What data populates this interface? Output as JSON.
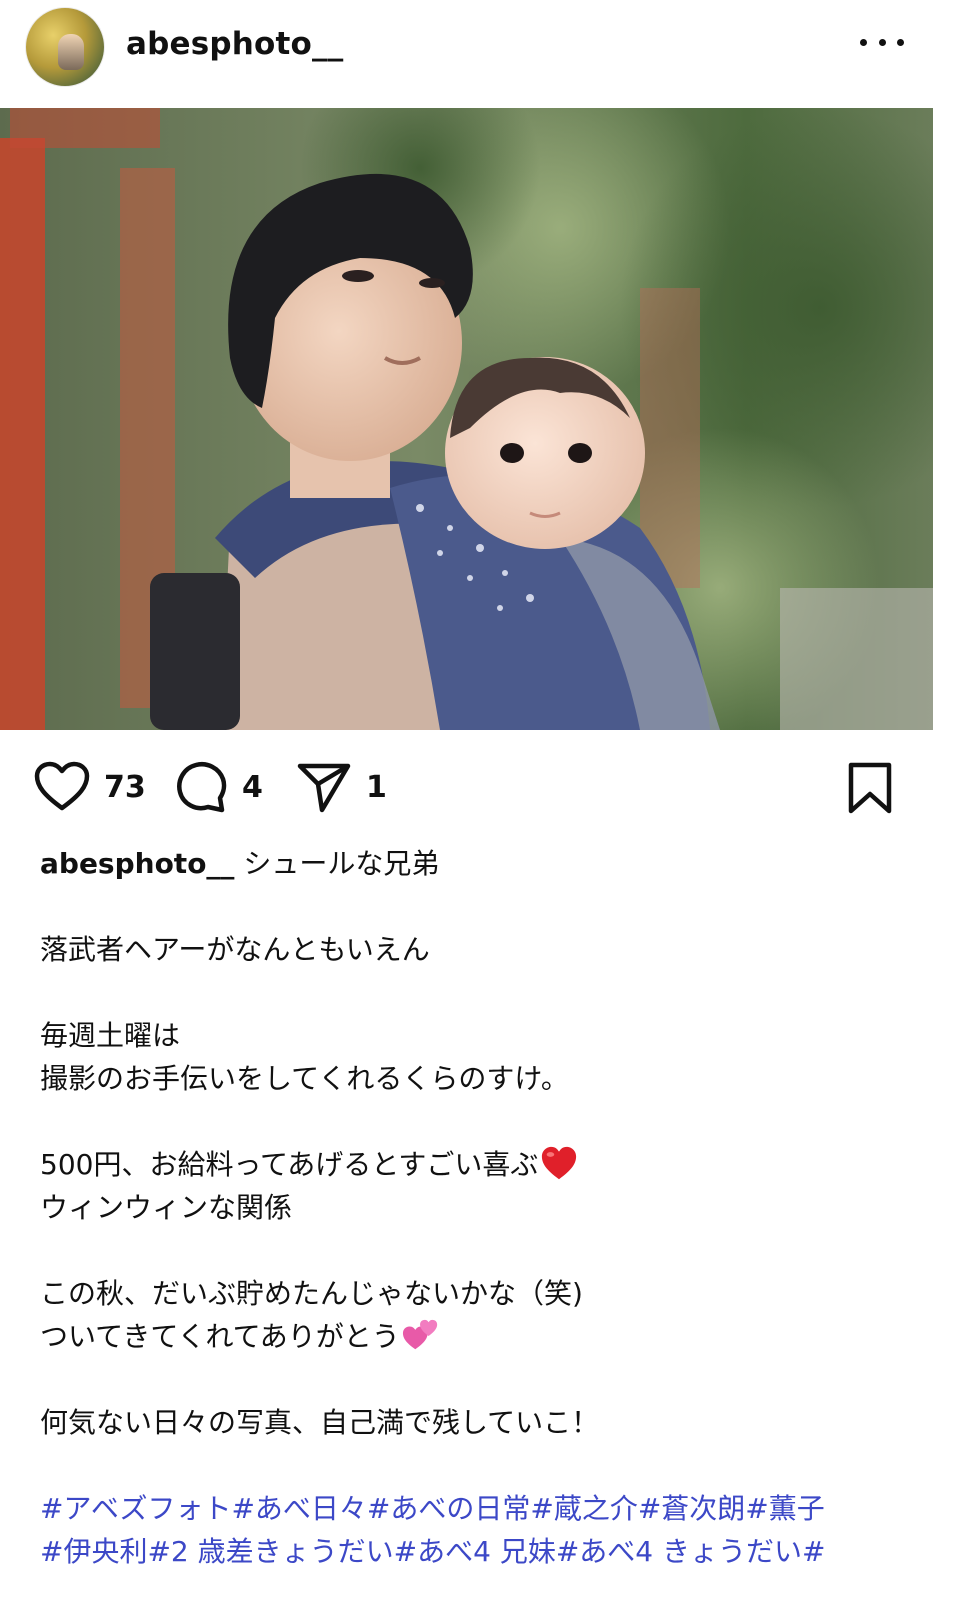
{
  "post": {
    "username": "abesphoto__",
    "more_icon": "more-horizontal-icon"
  },
  "actions": {
    "likes": "73",
    "comments": "4",
    "shares": "1",
    "like_icon": "heart-icon",
    "comment_icon": "comment-bubble-icon",
    "share_icon": "paper-plane-icon",
    "save_icon": "bookmark-icon"
  },
  "caption": {
    "username": "abesphoto__",
    "title": "シュールな兄弟",
    "lines": [
      "落武者ヘアーがなんともいえん",
      "",
      "毎週土曜は",
      "撮影のお手伝いをしてくれるくらのすけ。",
      "",
      "500円、お給料ってあげるとすごい喜ぶ",
      "ウィンウィンな関係",
      "",
      "この秋、だいぶ貯めたんじゃないかな（笑)",
      "ついてきてくれてありがとう",
      "",
      "何気ない日々の写真、自己満で残していこ！"
    ],
    "emoji": {
      "red_heart": "red-heart-emoji",
      "two_hearts": "two-hearts-emoji"
    },
    "hashtag_line_1": "#アベズフォト#あべ日々#あべの日常#蔵之介#蒼次朗#薫子",
    "hashtag_line_2": "#伊央利#2 歳差きょうだい#あべ4 兄妹#あべ4 きょうだい#"
  },
  "colors": {
    "text": "#111111",
    "hashtag": "#3c48c7",
    "heart_emoji": "#e0202a",
    "pink_hearts": "#e85aa8"
  }
}
